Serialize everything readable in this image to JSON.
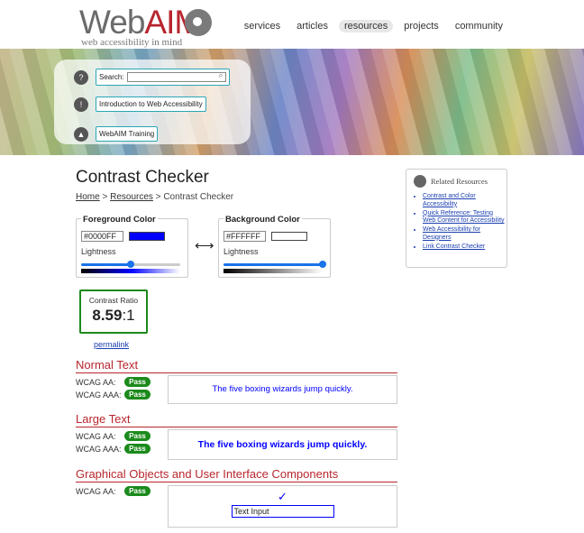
{
  "logo": {
    "word_plain": "Web",
    "word_accent": "AIM",
    "tagline": "web accessibility in mind"
  },
  "nav": [
    "services",
    "articles",
    "resources",
    "projects",
    "community"
  ],
  "quick_links": {
    "search_label": "Search:",
    "intro": "Introduction to Web Accessibility",
    "training": "WebAIM Training"
  },
  "page": {
    "title": "Contrast Checker",
    "breadcrumb": {
      "home": "Home",
      "sep1": " > ",
      "resources": "Resources",
      "sep2": " > ",
      "current": "Contrast Checker"
    }
  },
  "foreground": {
    "legend": "Foreground Color",
    "hex": "#0000FF",
    "swatch": "#0000ff",
    "lightness_label": "Lightness",
    "lightness": 0.5
  },
  "background": {
    "legend": "Background Color",
    "hex": "#FFFFFF",
    "swatch": "#ffffff",
    "lightness_label": "Lightness",
    "lightness": 1.0
  },
  "swap_glyph": "⟷",
  "ratio": {
    "label": "Contrast Ratio",
    "value": "8.59",
    "suffix": ":1",
    "permalink": "permalink"
  },
  "normal_text": {
    "heading": "Normal Text",
    "aa_label": "WCAG AA:",
    "aa_result": "Pass",
    "aaa_label": "WCAG AAA:",
    "aaa_result": "Pass",
    "sample": "The five boxing wizards jump quickly."
  },
  "large_text": {
    "heading": "Large Text",
    "aa_label": "WCAG AA:",
    "aa_result": "Pass",
    "aaa_label": "WCAG AAA:",
    "aaa_result": "Pass",
    "sample": "The five boxing wizards jump quickly."
  },
  "graphical": {
    "heading": "Graphical Objects and User Interface Components",
    "aa_label": "WCAG AA:",
    "aa_result": "Pass",
    "check_glyph": "✓",
    "input_value": "Text Input"
  },
  "related": {
    "title": "Related Resources",
    "links": [
      "Contrast and Color Accessibility",
      "Quick Reference: Testing Web Content for Accessibility",
      "Web Accessibility for Designers",
      "Link Contrast Checker"
    ]
  },
  "colors": {
    "accent": "#b8262e",
    "pass": "#1b8a1b",
    "link": "#1a3fb0"
  }
}
